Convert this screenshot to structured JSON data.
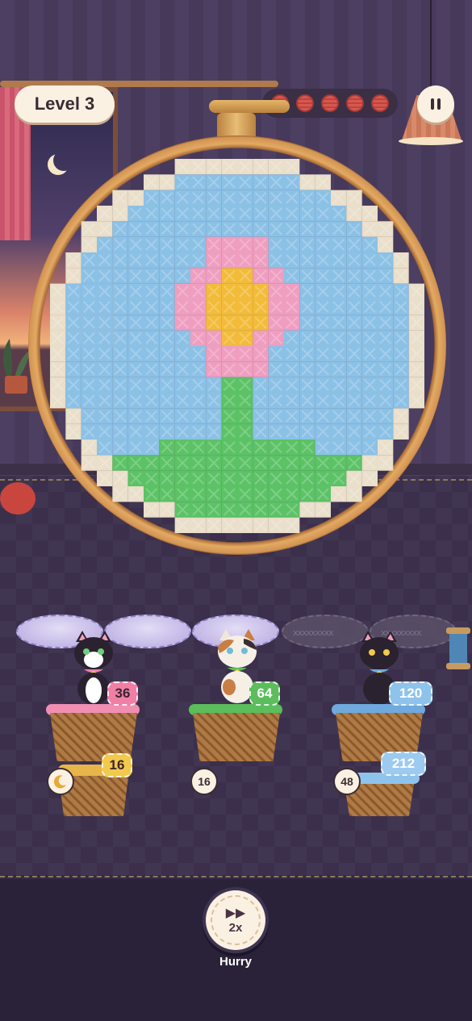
{
  "level": {
    "label": "Level 3"
  },
  "hud": {
    "lives_total": 5,
    "lives_icon": "yarn-ball-icon",
    "pause_icon": "pause-icon"
  },
  "pattern": {
    "name": "",
    "colors": {
      "sky": "#8cc1e6",
      "petal": "#ef9ec0",
      "center": "#f2bc3a",
      "stem": "#5cc266",
      "fabric": "#eadfca"
    }
  },
  "cushions": [
    {
      "state": "full"
    },
    {
      "state": "full"
    },
    {
      "state": "full"
    },
    {
      "state": "empty"
    },
    {
      "state": "empty"
    }
  ],
  "baskets": [
    {
      "cat": "tuxedo-cat",
      "color": "#f07fa6",
      "count": "36",
      "badge": "pink",
      "queue_count": "16",
      "queue_badge": "yellow",
      "queue_tag": "moon-icon"
    },
    {
      "cat": "calico-cat",
      "color": "#5bbd5b",
      "count": "64",
      "badge": "green",
      "queue_tag_text": "16"
    },
    {
      "cat": "black-cat",
      "color": "#6fa9dd",
      "count": "120",
      "badge": "blue",
      "queue_count": "212",
      "queue_badge": "blue2",
      "queue_tag_text": "48"
    }
  ],
  "hurry": {
    "multiplier": "2x",
    "label": "Hurry"
  }
}
